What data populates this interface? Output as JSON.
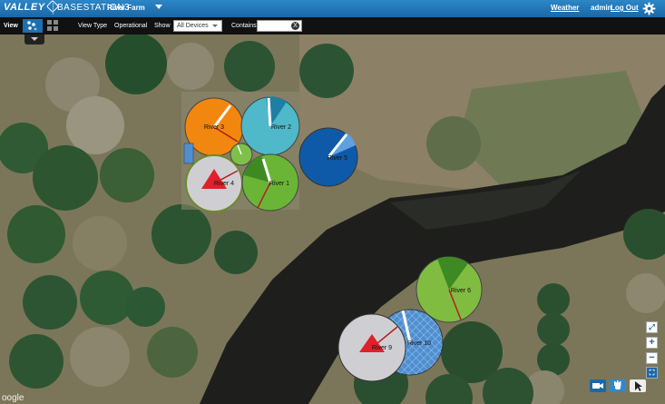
{
  "header": {
    "brand": "VALLEY",
    "product": "BASESTATION3",
    "farm_selector": "River Farm",
    "weather_link": "Weather",
    "user": "admin",
    "logout_link": "Log Out"
  },
  "toolbar": {
    "view_label": "View",
    "view_type_label": "View Type",
    "view_type_value": "Operational",
    "show_label": "Show",
    "show_value": "All Devices",
    "contains_label": "Contains",
    "contains_value": "",
    "clear_label": "X"
  },
  "map": {
    "pivots": [
      {
        "label": "River 3",
        "color": "#f2870f"
      },
      {
        "label": "River 2",
        "color": "#4fb8c9"
      },
      {
        "label": "River 5",
        "color": "#0f5aa8"
      },
      {
        "label": "River 4",
        "color": "#cfcfd3"
      },
      {
        "label": "River 1",
        "color": "#6ab536"
      },
      {
        "label": "River 6",
        "color": "#7fbc40"
      },
      {
        "label": "River 9",
        "color": "#cfcfd3"
      },
      {
        "label": "River 10",
        "color": "#4f8fd0"
      }
    ],
    "google_label": "oogle"
  },
  "colors": {
    "accent": "#1a68a8",
    "alert": "#e0202a"
  }
}
